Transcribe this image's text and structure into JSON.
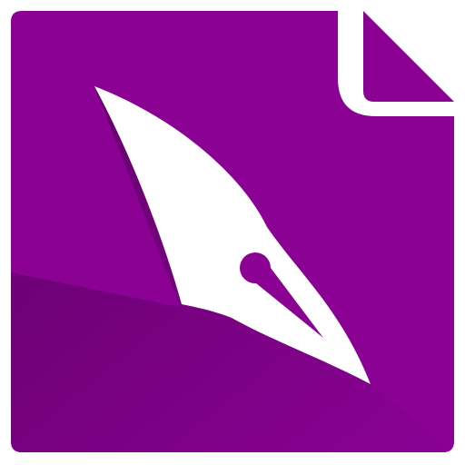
{
  "app_icon": {
    "semantic": "pen-document-app-icon",
    "colors": {
      "page_fill": "#8a0194",
      "page_shadow": "#6b0074",
      "folded_corner_fill": "#8a0194",
      "pen_nib": "#ffffff",
      "background": "#ffffff"
    }
  }
}
